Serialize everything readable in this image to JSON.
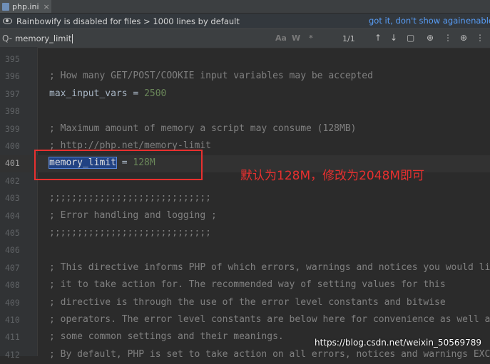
{
  "tab": {
    "label": "php.ini",
    "close": "×"
  },
  "banner": {
    "message": "Rainbowify is disabled for files > 1000 lines by default",
    "link_dismiss": "got it, don't show again",
    "link_enable": "enable"
  },
  "search": {
    "icon": "Q-",
    "value": "memory_limit",
    "opt_case": "Aa",
    "opt_word": "W",
    "opt_regex": "*",
    "match_count": "1/1",
    "btn_prev": "↑",
    "btn_next": "↓",
    "btn_select": "▢",
    "btn_add": "⊕",
    "btn_more": "⋮"
  },
  "colors": {
    "highlight_box": "#e8302f",
    "selection": "#214283",
    "comment": "#808080",
    "number": "#6a8759"
  },
  "lines": [
    {
      "n": "395",
      "text": ""
    },
    {
      "n": "396",
      "comment": "; How many GET/POST/COOKIE input variables may be accepted"
    },
    {
      "n": "397",
      "key": "max_input_vars = ",
      "value": "2500"
    },
    {
      "n": "398",
      "text": ""
    },
    {
      "n": "399",
      "comment": "; Maximum amount of memory a script may consume (128MB)"
    },
    {
      "n": "400",
      "comment": "; http://php.net/memory-limit"
    },
    {
      "n": "401",
      "match": "memory_limit",
      "key": " = ",
      "value": "128M"
    },
    {
      "n": "402",
      "text": ""
    },
    {
      "n": "403",
      "comment": ";;;;;;;;;;;;;;;;;;;;;;;;;;;;;"
    },
    {
      "n": "404",
      "comment": "; Error handling and logging ;"
    },
    {
      "n": "405",
      "comment": ";;;;;;;;;;;;;;;;;;;;;;;;;;;;;"
    },
    {
      "n": "406",
      "text": ""
    },
    {
      "n": "407",
      "comment": "; This directive informs PHP of which errors, warnings and notices you would li"
    },
    {
      "n": "408",
      "comment": "; it to take action for. The recommended way of setting values for this"
    },
    {
      "n": "409",
      "comment": "; directive is through the use of the error level constants and bitwise"
    },
    {
      "n": "410",
      "comment": "; operators. The error level constants are below here for convenience as well a"
    },
    {
      "n": "411",
      "comment": "; some common settings and their meanings."
    },
    {
      "n": "412",
      "comment": "; By default, PHP is set to take action on all errors, notices and warnings EXC"
    }
  ],
  "annotation": "默认为128M，修改为2048M即可",
  "watermark": "https://blog.csdn.net/weixin_50569789"
}
